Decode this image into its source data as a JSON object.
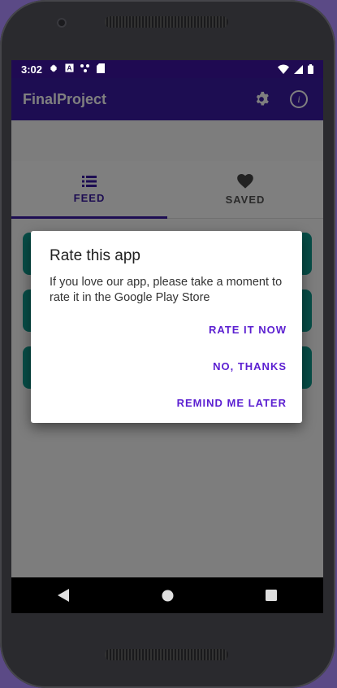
{
  "status_bar": {
    "time": "3:02"
  },
  "app_bar": {
    "title": "FinalProject"
  },
  "tabs": [
    {
      "label": "FEED",
      "icon": "list-icon",
      "active": true
    },
    {
      "label": "SAVED",
      "icon": "heart-icon",
      "active": false
    }
  ],
  "dialog": {
    "title": "Rate this app",
    "message": "If you love our app, please take a moment to rate it in the Google Play Store",
    "buttons": {
      "rate_now": "RATE IT NOW",
      "no_thanks": "NO, THANKS",
      "remind_later": "REMIND ME LATER"
    }
  },
  "colors": {
    "primary": "#3b1aa5",
    "status_bar": "#1f0a52",
    "accent_text": "#5b1fd1",
    "card": "#0f9b8e"
  }
}
